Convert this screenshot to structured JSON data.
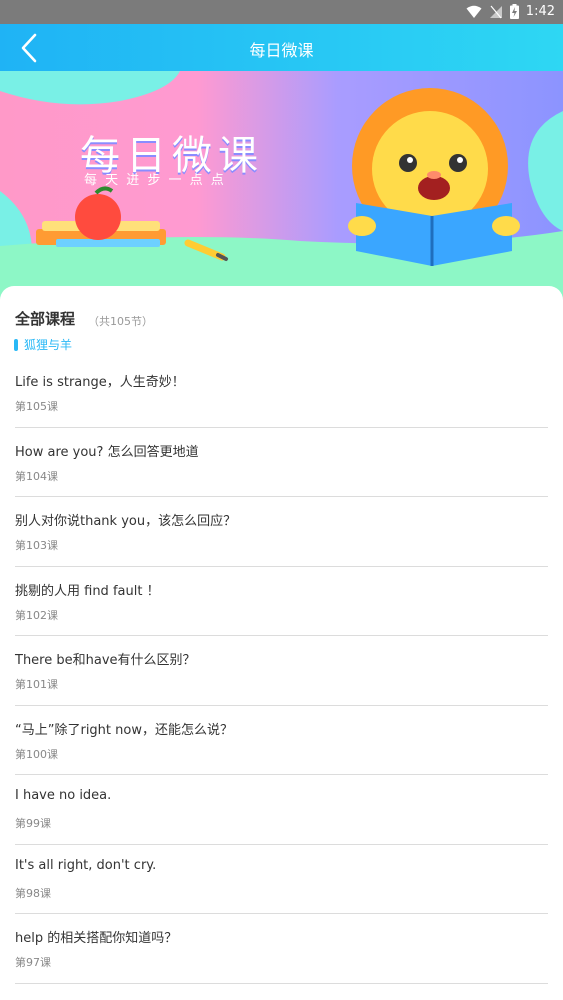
{
  "status": {
    "time": "1:42"
  },
  "header": {
    "title": "每日微课"
  },
  "banner": {
    "title": "每日微课",
    "subtitle": "每 天 进 步 一 点 点"
  },
  "section": {
    "title": "全部课程",
    "count": "（共105节）",
    "category": "狐狸与羊"
  },
  "lessons": [
    {
      "title": "Life is strange，人生奇妙！",
      "number": "第105课"
    },
    {
      "title": "How are you? 怎么回答更地道",
      "number": "第104课"
    },
    {
      "title": "别人对你说thank you，该怎么回应？",
      "number": "第103课"
    },
    {
      "title": "挑剔的人用 find fault ！",
      "number": "第102课"
    },
    {
      "title": "There be和have有什么区别？",
      "number": "第101课"
    },
    {
      "title": "“马上”除了right now，还能怎么说？",
      "number": "第100课"
    },
    {
      "title": "I have no idea.",
      "number": "第99课"
    },
    {
      "title": "It's all right, don't cry.",
      "number": "第98课"
    },
    {
      "title": "help 的相关搭配你知道吗？",
      "number": "第97课"
    }
  ],
  "colors": {
    "header_start": "#1fb3f5",
    "header_end": "#2ed7f3",
    "accent": "#29b8f6"
  }
}
